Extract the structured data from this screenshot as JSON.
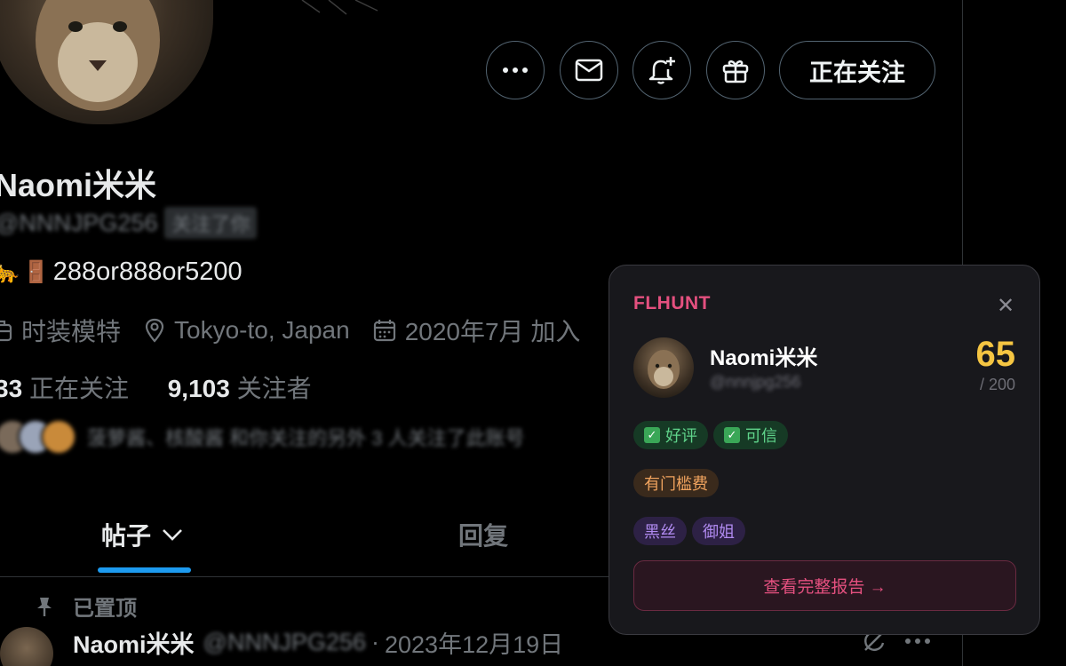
{
  "profile": {
    "name": "Naomi米米",
    "handle": "@NNNJPG256",
    "handle_badge": "关注了你",
    "bio": "288or888or5200",
    "bio_emojis": [
      "🐆",
      "🚪"
    ],
    "meta": {
      "profession": "时装模特",
      "location": "Tokyo-to, Japan",
      "joined": "2020年7月 加入"
    },
    "following_count": "33",
    "following_label": "正在关注",
    "followers_count": "9,103",
    "followers_label": "关注者",
    "followed_by_text": "菠萝酱、核酸酱 和你关注的另外 3 人关注了此账号"
  },
  "actions": {
    "more_icon": "more-icon",
    "message_icon": "mail-icon",
    "notify_icon": "bell-plus-icon",
    "gift_icon": "gift-icon",
    "follow_label": "正在关注"
  },
  "tabs": [
    {
      "label": "帖子",
      "active": true
    },
    {
      "label": "回复",
      "active": false
    }
  ],
  "tweet": {
    "pinned_label": "已置顶",
    "author_name": "Naomi米米",
    "author_handle": "@NNNJPG256",
    "separator": "·",
    "date": "2023年12月19日"
  },
  "flhunt": {
    "brand": "FLHUNT",
    "close_symbol": "✕",
    "name": "Naomi米米",
    "handle": "@nnnjpg256",
    "score": "65",
    "score_max": "/ 200",
    "tags_good": [
      "好评",
      "可信"
    ],
    "tags_warn": [
      "有门槛费"
    ],
    "tags_style": [
      "黑丝",
      "御姐"
    ],
    "check_symbol": "✓",
    "report_label": "查看完整报告 →"
  },
  "colors": {
    "accent_blue": "#1d9bf0",
    "flhunt_pink": "#e4507f",
    "score_yellow": "#f5c542"
  }
}
